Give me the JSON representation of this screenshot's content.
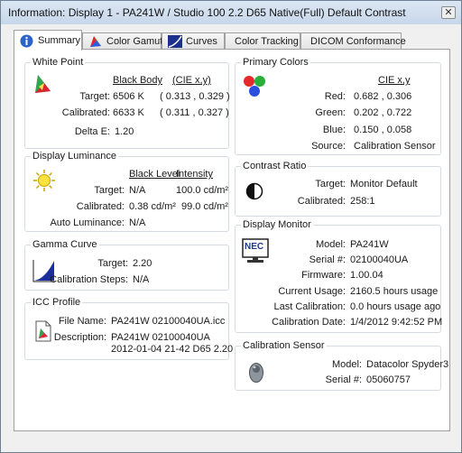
{
  "window": {
    "title": "Information: Display 1 - PA241W / Studio 100 2.2 D65 Native(Full) Default Contrast",
    "close_glyph": "✕"
  },
  "tabs": [
    {
      "label": "Summary",
      "icon": "info-icon"
    },
    {
      "label": "Color Gamut",
      "icon": "gamut-icon"
    },
    {
      "label": "Curves",
      "icon": "curves-icon"
    },
    {
      "label": "Color Tracking",
      "icon": ""
    },
    {
      "label": "DICOM Conformance",
      "icon": ""
    }
  ],
  "white_point": {
    "title": "White Point",
    "col_black_body": "Black Body",
    "col_cie": "(CIE x,y)",
    "target_label": "Target:",
    "target_value": "6506 K",
    "target_cie": "( 0.313 , 0.329 )",
    "calibrated_label": "Calibrated:",
    "calibrated_value": "6633 K",
    "calibrated_cie": "( 0.311 , 0.327 )",
    "delta_label": "Delta E:",
    "delta_value": "1.20"
  },
  "primary_colors": {
    "title": "Primary Colors",
    "col_cie": "CIE x,y",
    "red_label": "Red:",
    "red_value": "0.682 , 0.306",
    "green_label": "Green:",
    "green_value": "0.202 , 0.722",
    "blue_label": "Blue:",
    "blue_value": "0.150 , 0.058",
    "source_label": "Source:",
    "source_value": "Calibration Sensor"
  },
  "display_luminance": {
    "title": "Display Luminance",
    "col_black_level": "Black Level",
    "col_intensity": "Intensity",
    "target_label": "Target:",
    "target_black": "N/A",
    "target_intensity": "100.0 cd/m²",
    "calibrated_label": "Calibrated:",
    "calibrated_black": "0.38 cd/m²",
    "calibrated_intensity": "99.0 cd/m²",
    "auto_label": "Auto Luminance:",
    "auto_value": "N/A"
  },
  "contrast_ratio": {
    "title": "Contrast Ratio",
    "target_label": "Target:",
    "target_value": "Monitor Default",
    "calibrated_label": "Calibrated:",
    "calibrated_value": "258:1"
  },
  "gamma_curve": {
    "title": "Gamma Curve",
    "target_label": "Target:",
    "target_value": "2.20",
    "steps_label": "Calibration Steps:",
    "steps_value": "N/A"
  },
  "display_monitor": {
    "title": "Display Monitor",
    "logo": "NEC",
    "model_label": "Model:",
    "model_value": "PA241W",
    "serial_label": "Serial #:",
    "serial_value": "02100040UA",
    "firmware_label": "Firmware:",
    "firmware_value": "1.00.04",
    "usage_label": "Current Usage:",
    "usage_value": "2160.5 hours usage",
    "last_label": "Last Calibration:",
    "last_value": "0.0 hours usage ago",
    "date_label": "Calibration Date:",
    "date_value": "1/4/2012 9:42:52 PM"
  },
  "icc_profile": {
    "title": "ICC Profile",
    "filename_label": "File Name:",
    "filename_value": "PA241W 02100040UA.icc",
    "description_label": "Description:",
    "description_line1": "PA241W 02100040UA",
    "description_line2": "2012-01-04 21-42 D65 2.20"
  },
  "calibration_sensor": {
    "title": "Calibration Sensor",
    "model_label": "Model:",
    "model_value": "Datacolor Spyder3",
    "serial_label": "Serial #:",
    "serial_value": "05060757"
  }
}
